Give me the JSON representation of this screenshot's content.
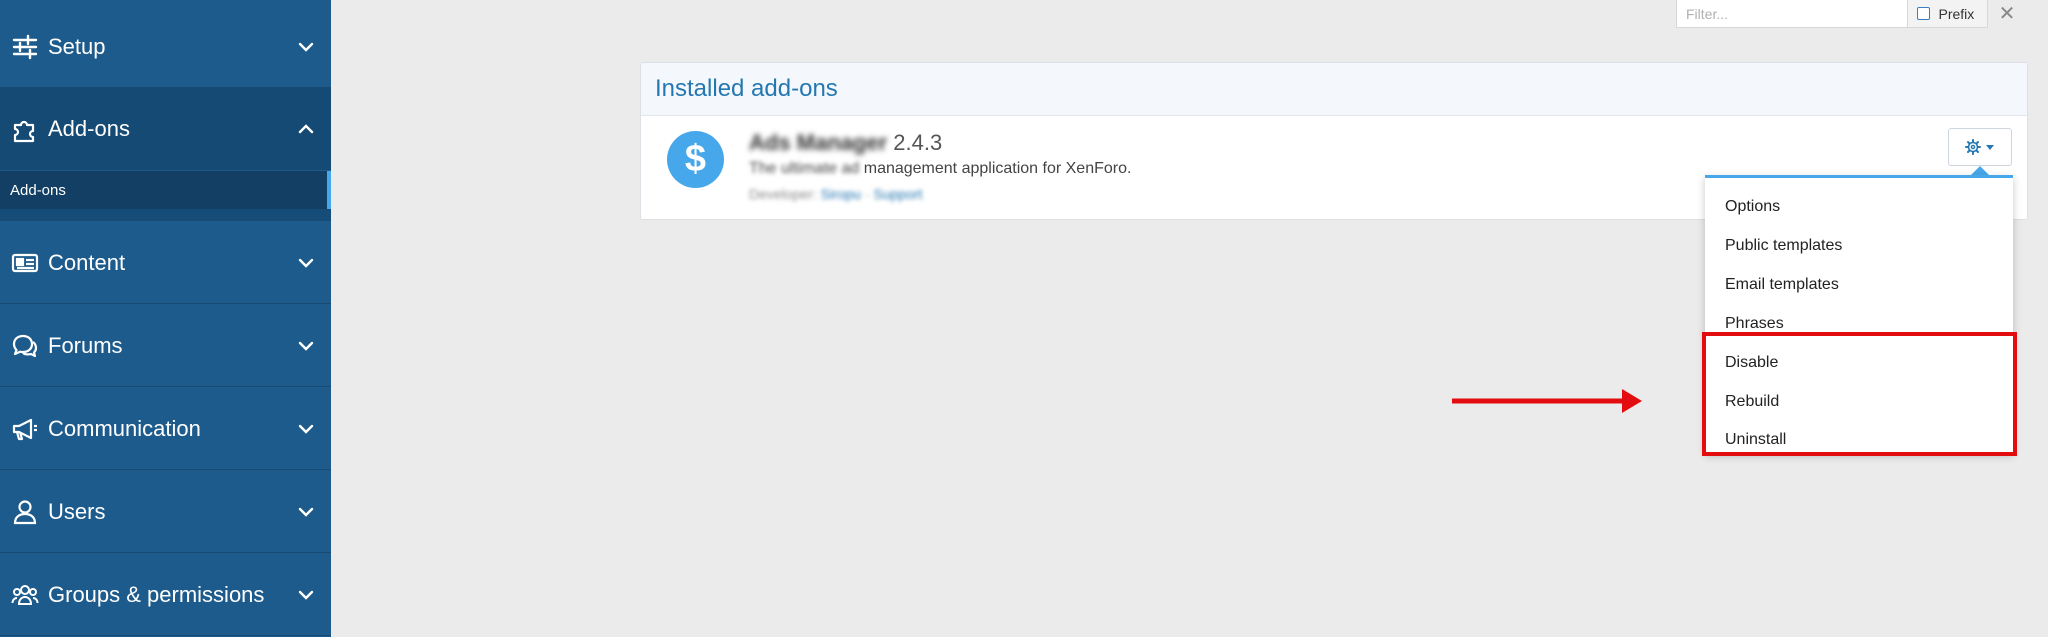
{
  "sidebar": {
    "sections": [
      {
        "label": "Setup",
        "icon": "sliders-icon",
        "state": "collapsed"
      },
      {
        "label": "Add-ons",
        "icon": "puzzle-icon",
        "state": "expanded"
      },
      {
        "label": "Content",
        "icon": "newspaper-icon",
        "state": "collapsed"
      },
      {
        "label": "Forums",
        "icon": "comments-icon",
        "state": "collapsed"
      },
      {
        "label": "Communication",
        "icon": "megaphone-icon",
        "state": "collapsed"
      },
      {
        "label": "Users",
        "icon": "user-icon",
        "state": "collapsed"
      },
      {
        "label": "Groups & permissions",
        "icon": "users-icon",
        "state": "collapsed"
      }
    ],
    "active_subitem": "Add-ons"
  },
  "filter": {
    "placeholder": "Filter...",
    "prefix_label": "Prefix",
    "close_symbol": "✕"
  },
  "panel": {
    "title": "Installed add-ons",
    "addon": {
      "name": "Ads Manager",
      "version": "2.4.3",
      "description_blurred": "The ultimate ad",
      "description_visible": "management application for XenForo.",
      "developer_label": "Developer:",
      "developer_name": "Siropu",
      "support_label": "Support",
      "icon_glyph": "$"
    }
  },
  "menu": {
    "items": [
      "Options",
      "Public templates",
      "Email templates",
      "Phrases",
      "Disable",
      "Rebuild",
      "Uninstall"
    ],
    "highlighted_items": [
      "Disable",
      "Rebuild",
      "Uninstall"
    ]
  },
  "colors": {
    "sidebar_bg": "#1d5b8c",
    "accent": "#47a7eb",
    "annotation": "#e30d10",
    "link": "#2577b1"
  }
}
